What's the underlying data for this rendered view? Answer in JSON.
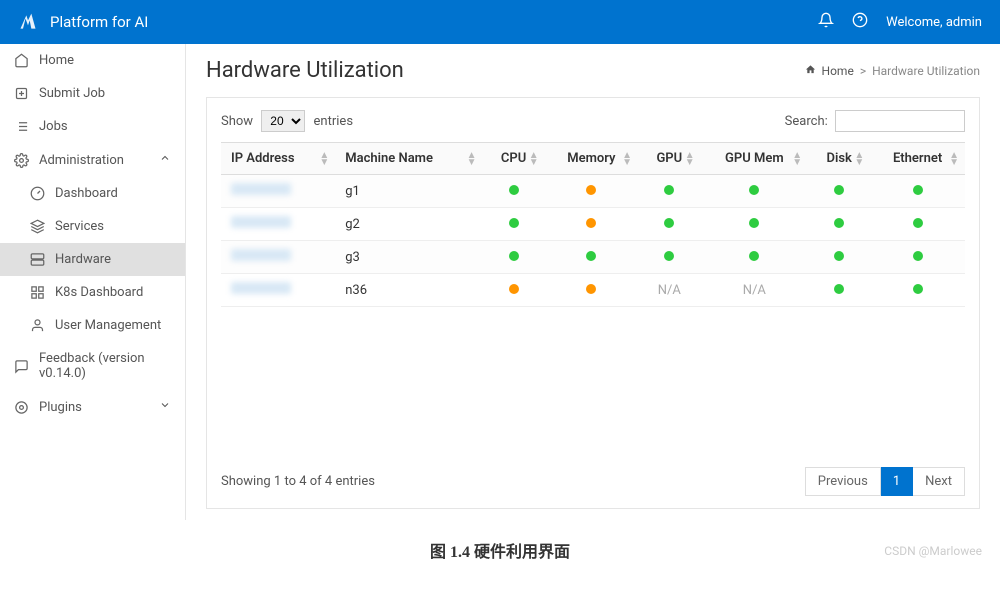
{
  "header": {
    "brand": "Platform for AI",
    "welcome": "Welcome, admin"
  },
  "sidebar": {
    "items": [
      {
        "label": "Home",
        "key": "home"
      },
      {
        "label": "Submit Job",
        "key": "submit"
      },
      {
        "label": "Jobs",
        "key": "jobs"
      },
      {
        "label": "Administration",
        "key": "admin"
      },
      {
        "label": "Dashboard",
        "key": "dashboard"
      },
      {
        "label": "Services",
        "key": "services"
      },
      {
        "label": "Hardware",
        "key": "hardware"
      },
      {
        "label": "K8s Dashboard",
        "key": "k8s"
      },
      {
        "label": "User Management",
        "key": "users"
      },
      {
        "label": "Feedback (version v0.14.0)",
        "key": "feedback"
      },
      {
        "label": "Plugins",
        "key": "plugins"
      }
    ]
  },
  "page": {
    "title": "Hardware Utilization",
    "breadcrumb_home": "Home",
    "breadcrumb_sep": ">",
    "breadcrumb_current": "Hardware Utilization"
  },
  "table": {
    "show_label": "Show",
    "entries_label": "entries",
    "entries_value": "20",
    "search_label": "Search:",
    "columns": [
      "IP Address",
      "Machine Name",
      "CPU",
      "Memory",
      "GPU",
      "GPU Mem",
      "Disk",
      "Ethernet"
    ],
    "rows": [
      {
        "ip": "",
        "name": "g1",
        "cpu": "green",
        "memory": "orange",
        "gpu": "green",
        "gpumem": "green",
        "disk": "green",
        "eth": "green"
      },
      {
        "ip": "",
        "name": "g2",
        "cpu": "green",
        "memory": "orange",
        "gpu": "green",
        "gpumem": "green",
        "disk": "green",
        "eth": "green"
      },
      {
        "ip": "",
        "name": "g3",
        "cpu": "green",
        "memory": "green",
        "gpu": "green",
        "gpumem": "green",
        "disk": "green",
        "eth": "green"
      },
      {
        "ip": "",
        "name": "n36",
        "cpu": "orange",
        "memory": "orange",
        "gpu": "N/A",
        "gpumem": "N/A",
        "disk": "green",
        "eth": "green"
      }
    ],
    "info": "Showing 1 to 4 of 4 entries",
    "prev": "Previous",
    "page": "1",
    "next": "Next"
  },
  "caption": "图 1.4 硬件利用界面",
  "watermark": "CSDN @Marlowee"
}
